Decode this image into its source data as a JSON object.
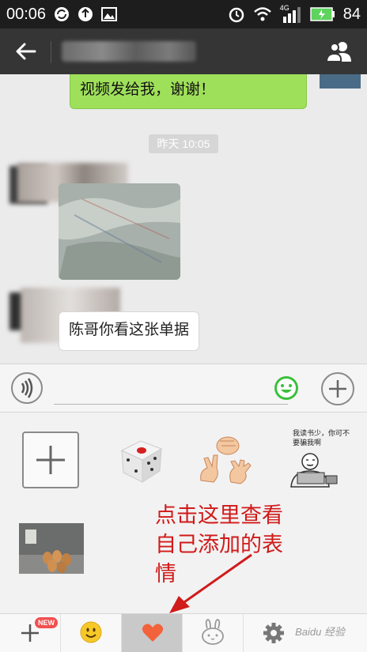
{
  "status_bar": {
    "time": "00:06",
    "network": "4G",
    "battery": "84",
    "icons": [
      "sync-icon",
      "upload-icon",
      "image-icon",
      "alarm-icon",
      "wifi-icon",
      "signal-icon",
      "battery-icon"
    ]
  },
  "header": {
    "back_icon": "arrow-left-icon",
    "group_icon": "people-icon"
  },
  "chat": {
    "sent_message": "视频发给我，谢谢！",
    "timestamp": "昨天 10:05",
    "received_text": "陈哥你看这张单据"
  },
  "input_bar": {
    "voice_icon": "voice-icon",
    "emoji_icon": "smiley-icon",
    "plus_icon": "plus-circle-icon"
  },
  "sticker_panel": {
    "meme_caption": "我读书少，你可不要骗我啊",
    "annotation": "点击这里查看自己添加的表情"
  },
  "tabs": {
    "new_badge": "NEW",
    "active_index": 2,
    "items": [
      "add-tab",
      "emoji-tab",
      "heart-tab",
      "rabbit-tab",
      "settings-tab"
    ]
  },
  "watermark": "Baidu 经验",
  "colors": {
    "accent_green": "#9fe05a",
    "annotation_red": "#d11a1a",
    "heart": "#f2623b"
  }
}
